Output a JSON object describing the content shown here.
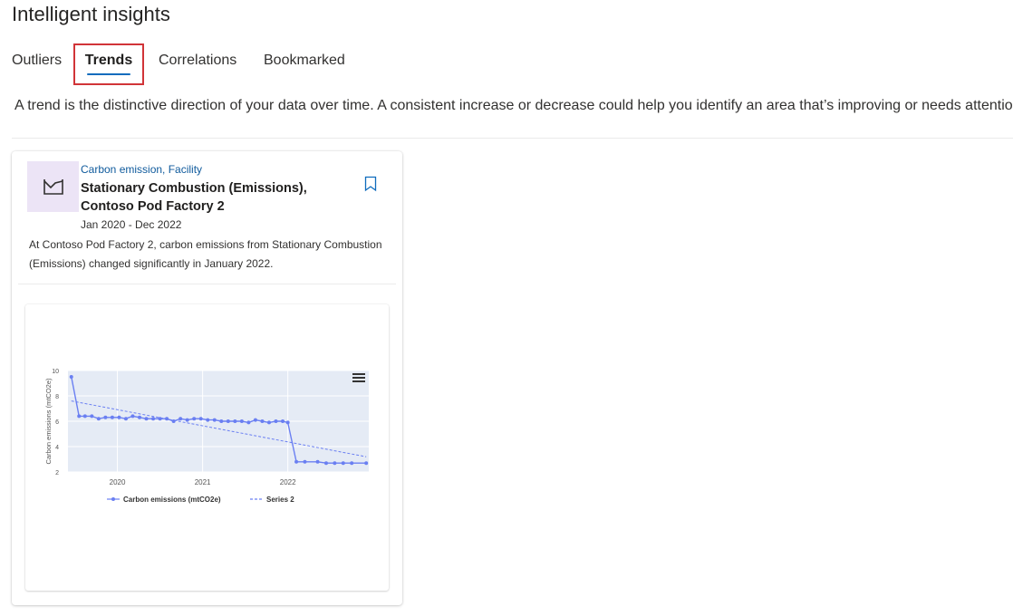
{
  "page": {
    "title": "Intelligent insights"
  },
  "tabs": [
    {
      "label": "Outliers",
      "selected": false
    },
    {
      "label": "Trends",
      "selected": true
    },
    {
      "label": "Correlations",
      "selected": false
    },
    {
      "label": "Bookmarked",
      "selected": false
    }
  ],
  "description": "A trend is the distinctive direction of your data over time. A consistent increase or decrease could help you identify an area that’s improving or needs attention.",
  "card": {
    "icon": "trend-chart-icon",
    "category": "Carbon emission, Facility",
    "title": "Stationary Combustion (Emissions), Contoso Pod Factory 2",
    "date_range": "Jan 2020 - Dec 2022",
    "summary": "At Contoso Pod Factory 2, carbon emissions from Stationary Combustion (Emissions) changed significantly in January 2022.",
    "bookmark_icon": "bookmark-icon"
  },
  "colors": {
    "accent": "#0f6cbd",
    "highlight_border": "#d13438",
    "series": "#6a7ff2",
    "plot_bg": "#e5ebf5",
    "icon_bg": "#ece4f6"
  },
  "chart_data": {
    "type": "line",
    "ylabel": "Carbon emissions (mtCO2e)",
    "xlabel": "",
    "ylim": [
      2,
      10
    ],
    "yticks": [
      "2",
      "4",
      "6",
      "8",
      "10"
    ],
    "x_ticks": [
      "2020",
      "2021",
      "2022"
    ],
    "x_range": [
      2019.42,
      2022.95
    ],
    "grid": true,
    "legend_position": "bottom",
    "series": [
      {
        "name": "Carbon emissions (mtCO2e)",
        "style": "line-markers",
        "x": [
          2019.46,
          2019.55,
          2019.62,
          2019.7,
          2019.78,
          2019.86,
          2019.94,
          2020.02,
          2020.1,
          2020.18,
          2020.26,
          2020.34,
          2020.42,
          2020.5,
          2020.58,
          2020.66,
          2020.74,
          2020.82,
          2020.9,
          2020.98,
          2021.06,
          2021.14,
          2021.22,
          2021.3,
          2021.38,
          2021.46,
          2021.54,
          2021.62,
          2021.7,
          2021.78,
          2021.86,
          2021.94,
          2022.0,
          2022.1,
          2022.2,
          2022.35,
          2022.45,
          2022.55,
          2022.65,
          2022.75,
          2022.92
        ],
        "values": [
          9.5,
          6.4,
          6.4,
          6.4,
          6.2,
          6.3,
          6.3,
          6.3,
          6.2,
          6.4,
          6.3,
          6.2,
          6.2,
          6.2,
          6.2,
          6.0,
          6.2,
          6.1,
          6.2,
          6.2,
          6.1,
          6.1,
          6.0,
          6.0,
          6.0,
          6.0,
          5.9,
          6.1,
          6.0,
          5.9,
          6.0,
          6.0,
          5.9,
          2.8,
          2.8,
          2.8,
          2.7,
          2.7,
          2.7,
          2.7,
          2.7
        ]
      },
      {
        "name": "Series 2",
        "style": "dashed",
        "x": [
          2019.46,
          2022.92
        ],
        "values": [
          7.6,
          3.2
        ]
      }
    ]
  }
}
